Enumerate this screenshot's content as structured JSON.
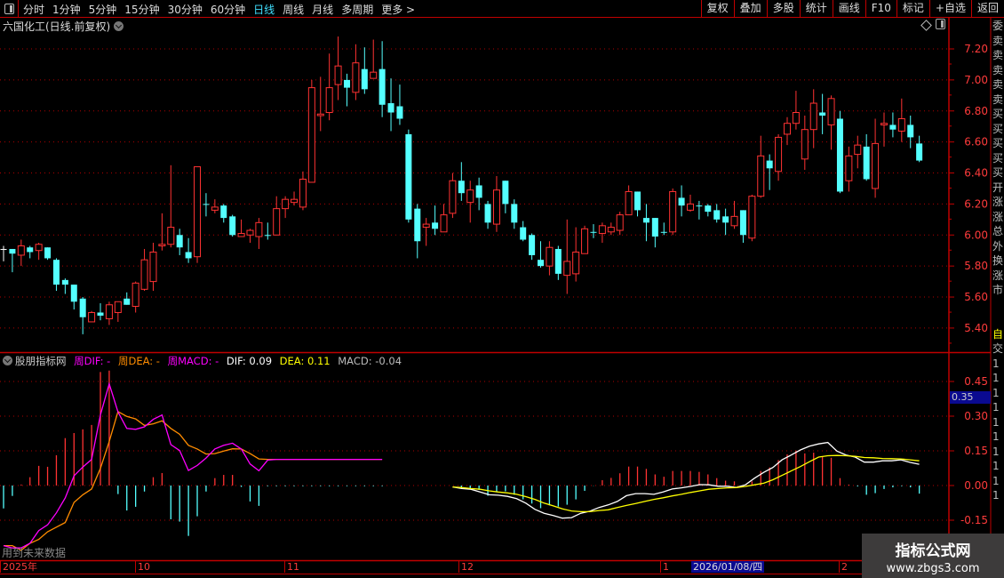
{
  "toolbar": {
    "periods": [
      "分时",
      "1分钟",
      "5分钟",
      "15分钟",
      "30分钟",
      "60分钟",
      "日线",
      "周线",
      "月线",
      "多周期",
      "更多 >"
    ],
    "active_period": "日线",
    "buttons": [
      "复权",
      "叠加",
      "多股",
      "统计",
      "画线",
      "F10",
      "标记",
      "+自选",
      "返回"
    ]
  },
  "title": "六国化工(日线.前复权)",
  "colors": {
    "up": "#ff3232",
    "down": "#54ffff",
    "flat": "#ffffff",
    "grid": "#b00000",
    "axis": "#ff3b3b",
    "wdif": "#ff00ff",
    "wdea": "#ff8c00",
    "dif": "#ffffff",
    "dea": "#ffff00"
  },
  "legend": {
    "name": "股朋指标网",
    "wdif": "周DIF: -",
    "wdea": "周DEA: -",
    "wmacd": "周MACD: -",
    "dif": "DIF: 0.09",
    "dea": "DEA: 0.11",
    "macd": "MACD: -0.04"
  },
  "warning": "用到未来数据",
  "highlight_value": "0.35",
  "time_axis": {
    "labels": [
      "2025年",
      "10",
      "11",
      "12",
      "1",
      "2"
    ],
    "cursor_date": "2026/01/08/四"
  },
  "side_panel": [
    "委",
    "卖",
    "卖",
    "卖",
    "卖",
    "卖",
    "买",
    "买",
    "买",
    "买",
    "买",
    "开",
    "涨",
    "涨",
    "总",
    "外",
    "换",
    "涨",
    "市",
    "",
    "",
    "自",
    "交",
    "1",
    "1",
    "1",
    "1",
    "1",
    "1",
    "1",
    "1",
    "1",
    "1"
  ],
  "watermark": {
    "name": "指标公式网",
    "url": "www.zbgs3.com"
  },
  "chart_data": [
    {
      "type": "candlestick",
      "ylim": [
        5.3,
        7.3
      ],
      "y_ticks": [
        "7.20",
        "7.00",
        "6.80",
        "6.60",
        "6.40",
        "6.20",
        "6.00",
        "5.80",
        "5.60",
        "5.40"
      ],
      "grid": true,
      "ohlc": [
        [
          5.91,
          5.93,
          5.83,
          5.91
        ],
        [
          5.91,
          5.91,
          5.76,
          5.88
        ],
        [
          5.87,
          5.97,
          5.8,
          5.93
        ],
        [
          5.92,
          5.93,
          5.85,
          5.89
        ],
        [
          5.9,
          5.95,
          5.84,
          5.94
        ],
        [
          5.92,
          5.92,
          5.84,
          5.85
        ],
        [
          5.84,
          5.85,
          5.64,
          5.68
        ],
        [
          5.71,
          5.72,
          5.62,
          5.68
        ],
        [
          5.68,
          5.68,
          5.52,
          5.57
        ],
        [
          5.59,
          5.6,
          5.36,
          5.47
        ],
        [
          5.44,
          5.51,
          5.44,
          5.5
        ],
        [
          5.5,
          5.56,
          5.45,
          5.48
        ],
        [
          5.46,
          5.57,
          5.42,
          5.55
        ],
        [
          5.5,
          5.57,
          5.44,
          5.57
        ],
        [
          5.59,
          5.63,
          5.55,
          5.55
        ],
        [
          5.54,
          5.7,
          5.5,
          5.69
        ],
        [
          5.65,
          5.91,
          5.64,
          5.84
        ],
        [
          5.7,
          5.95,
          5.64,
          5.89
        ],
        [
          5.93,
          6.14,
          5.9,
          5.94
        ],
        [
          5.94,
          6.45,
          5.92,
          6.05
        ],
        [
          6.0,
          6.04,
          5.87,
          5.92
        ],
        [
          5.89,
          5.98,
          5.82,
          5.85
        ],
        [
          5.86,
          6.44,
          5.82,
          6.44
        ],
        [
          6.2,
          6.27,
          6.12,
          6.2
        ],
        [
          6.16,
          6.23,
          6.14,
          6.18
        ],
        [
          6.19,
          6.2,
          6.08,
          6.11
        ],
        [
          6.12,
          6.13,
          5.99,
          6.0
        ],
        [
          5.99,
          6.1,
          5.99,
          6.01
        ],
        [
          6.0,
          6.04,
          5.95,
          6.03
        ],
        [
          5.99,
          6.11,
          5.91,
          6.08
        ],
        [
          6.0,
          6.08,
          5.97,
          6.0
        ],
        [
          6.0,
          6.25,
          6.0,
          6.17
        ],
        [
          6.17,
          6.25,
          6.11,
          6.23
        ],
        [
          6.21,
          6.28,
          6.19,
          6.23
        ],
        [
          6.18,
          6.41,
          6.16,
          6.36
        ],
        [
          6.34,
          7.0,
          6.34,
          6.95
        ],
        [
          6.77,
          7.02,
          6.67,
          6.78
        ],
        [
          6.79,
          7.17,
          6.74,
          6.95
        ],
        [
          6.97,
          7.28,
          6.87,
          7.09
        ],
        [
          7.0,
          7.04,
          6.83,
          6.95
        ],
        [
          6.92,
          7.23,
          6.87,
          7.11
        ],
        [
          7.07,
          7.21,
          6.91,
          6.94
        ],
        [
          7.01,
          7.26,
          7.01,
          7.05
        ],
        [
          7.07,
          7.25,
          6.76,
          6.84
        ],
        [
          6.85,
          7.01,
          6.67,
          6.79
        ],
        [
          6.83,
          6.97,
          6.71,
          6.75
        ],
        [
          6.65,
          6.68,
          6.08,
          6.1
        ],
        [
          6.17,
          6.2,
          5.85,
          5.96
        ],
        [
          6.05,
          6.11,
          5.93,
          6.07
        ],
        [
          6.08,
          6.19,
          6.0,
          6.04
        ],
        [
          6.02,
          6.2,
          6.02,
          6.13
        ],
        [
          6.14,
          6.4,
          6.11,
          6.35
        ],
        [
          6.35,
          6.47,
          6.22,
          6.27
        ],
        [
          6.21,
          6.35,
          6.08,
          6.29
        ],
        [
          6.32,
          6.37,
          6.16,
          6.24
        ],
        [
          6.2,
          6.22,
          6.04,
          6.08
        ],
        [
          6.07,
          6.38,
          6.02,
          6.29
        ],
        [
          6.35,
          6.35,
          6.14,
          6.2
        ],
        [
          6.2,
          6.23,
          6.04,
          6.08
        ],
        [
          6.05,
          6.09,
          5.96,
          5.97
        ],
        [
          6.0,
          6.01,
          5.84,
          5.87
        ],
        [
          5.84,
          5.96,
          5.79,
          5.8
        ],
        [
          5.8,
          5.96,
          5.74,
          5.92
        ],
        [
          5.91,
          5.93,
          5.71,
          5.75
        ],
        [
          5.74,
          6.1,
          5.62,
          5.83
        ],
        [
          5.75,
          6.05,
          5.7,
          5.89
        ],
        [
          5.88,
          6.06,
          5.88,
          6.04
        ],
        [
          6.02,
          6.07,
          5.98,
          6.02
        ],
        [
          6.01,
          6.08,
          5.95,
          6.06
        ],
        [
          6.02,
          6.08,
          6.0,
          6.05
        ],
        [
          6.03,
          6.15,
          6.0,
          6.13
        ],
        [
          6.13,
          6.32,
          6.13,
          6.28
        ],
        [
          6.28,
          6.28,
          6.12,
          6.16
        ],
        [
          6.11,
          6.2,
          5.96,
          6.08
        ],
        [
          6.11,
          6.11,
          5.92,
          5.99
        ],
        [
          6.02,
          6.08,
          6.0,
          6.02
        ],
        [
          6.02,
          6.3,
          6.0,
          6.28
        ],
        [
          6.24,
          6.32,
          6.12,
          6.19
        ],
        [
          6.16,
          6.26,
          6.15,
          6.2
        ],
        [
          6.19,
          6.22,
          6.1,
          6.19
        ],
        [
          6.19,
          6.2,
          6.12,
          6.15
        ],
        [
          6.16,
          6.2,
          6.08,
          6.1
        ],
        [
          6.12,
          6.17,
          6.0,
          6.08
        ],
        [
          6.06,
          6.22,
          6.04,
          6.12
        ],
        [
          6.16,
          6.16,
          5.95,
          6.0
        ],
        [
          5.98,
          6.26,
          5.96,
          6.25
        ],
        [
          6.25,
          6.64,
          6.24,
          6.51
        ],
        [
          6.48,
          6.52,
          6.29,
          6.43
        ],
        [
          6.41,
          6.65,
          6.35,
          6.63
        ],
        [
          6.65,
          6.76,
          6.58,
          6.72
        ],
        [
          6.72,
          6.93,
          6.68,
          6.79
        ],
        [
          6.49,
          6.77,
          6.42,
          6.68
        ],
        [
          6.68,
          6.94,
          6.56,
          6.85
        ],
        [
          6.79,
          6.91,
          6.65,
          6.77
        ],
        [
          6.71,
          6.9,
          6.55,
          6.88
        ],
        [
          6.75,
          6.8,
          6.27,
          6.28
        ],
        [
          6.35,
          6.57,
          6.28,
          6.51
        ],
        [
          6.52,
          6.64,
          6.43,
          6.58
        ],
        [
          6.57,
          6.65,
          6.35,
          6.36
        ],
        [
          6.3,
          6.75,
          6.24,
          6.59
        ],
        [
          6.71,
          6.79,
          6.57,
          6.72
        ],
        [
          6.71,
          6.79,
          6.63,
          6.68
        ],
        [
          6.67,
          6.88,
          6.6,
          6.75
        ],
        [
          6.71,
          6.77,
          6.56,
          6.63
        ],
        [
          6.59,
          6.64,
          6.47,
          6.48
        ]
      ]
    },
    {
      "type": "macd",
      "ylim": [
        -0.3,
        0.5
      ],
      "y_ticks": [
        "0.45",
        "0.30",
        "0.15",
        "0.00",
        "-0.15"
      ],
      "grid": true,
      "weekly": {
        "dif": [
          -0.26,
          -0.27,
          -0.27,
          -0.25,
          -0.195,
          -0.17,
          -0.118,
          -0.054,
          0.042,
          0.08,
          0.113,
          0.305,
          0.44,
          0.318,
          0.247,
          0.243,
          0.254,
          0.286,
          0.305,
          0.177,
          0.151,
          0.065,
          0.087,
          0.119,
          0.158,
          0.174,
          0.183,
          0.158,
          0.093,
          0.064,
          0.11,
          0.113,
          0.113,
          0.113,
          0.113,
          0.113,
          0.113,
          0.113,
          0.113,
          0.113,
          0.113,
          0.113,
          0.113,
          0.113
        ],
        "dea": [
          -0.26,
          -0.26,
          -0.28,
          -0.25,
          -0.233,
          -0.2,
          -0.18,
          -0.16,
          -0.073,
          -0.04,
          -0.015,
          0.074,
          0.19,
          0.32,
          0.299,
          0.288,
          0.26,
          0.267,
          0.28,
          0.247,
          0.222,
          0.174,
          0.158,
          0.136,
          0.138,
          0.149,
          0.159,
          0.158,
          0.138,
          0.115,
          0.113,
          0.113,
          0.113,
          0.113,
          0.113,
          0.113,
          0.113,
          0.113,
          0.113,
          0.113,
          0.113,
          0.113,
          0.113,
          0.113
        ],
        "macd": [
          -0.099,
          -0.045,
          0.004,
          0.036,
          0.085,
          0.081,
          0.131,
          0.205,
          0.227,
          0.243,
          0.262,
          0.491,
          0.497,
          -0.037,
          -0.108,
          -0.092,
          -0.026,
          0.036,
          0.054,
          -0.146,
          -0.156,
          -0.218,
          -0.133,
          -0.026,
          0.032,
          0.046,
          0.046,
          -0.006,
          -0.069,
          -0.088,
          -0.003,
          -0.003,
          -0.003,
          -0.003,
          -0.003,
          -0.003,
          -0.003,
          -0.003,
          -0.003,
          -0.003,
          -0.003,
          -0.003,
          -0.003,
          -0.003
        ]
      },
      "daily": {
        "dif": [
          -0.006,
          -0.013,
          -0.016,
          -0.028,
          -0.04,
          -0.042,
          -0.047,
          -0.057,
          -0.076,
          -0.103,
          -0.12,
          -0.13,
          -0.141,
          -0.139,
          -0.12,
          -0.111,
          -0.095,
          -0.084,
          -0.069,
          -0.044,
          -0.035,
          -0.035,
          -0.038,
          -0.028,
          -0.015,
          -0.01,
          -0.004,
          0.004,
          0.003,
          -0.003,
          -0.003,
          -0.008,
          0.003,
          0.032,
          0.057,
          0.078,
          0.111,
          0.132,
          0.154,
          0.17,
          0.18,
          0.186,
          0.149,
          0.132,
          0.123,
          0.101,
          0.101,
          0.107,
          0.107,
          0.111,
          0.1,
          0.092
        ],
        "dea": [
          -0.006,
          -0.009,
          -0.013,
          -0.016,
          -0.023,
          -0.028,
          -0.032,
          -0.038,
          -0.048,
          -0.06,
          -0.076,
          -0.088,
          -0.101,
          -0.11,
          -0.113,
          -0.113,
          -0.108,
          -0.105,
          -0.095,
          -0.086,
          -0.078,
          -0.069,
          -0.06,
          -0.053,
          -0.045,
          -0.038,
          -0.03,
          -0.023,
          -0.016,
          -0.013,
          -0.01,
          -0.009,
          -0.004,
          0.003,
          0.01,
          0.025,
          0.044,
          0.063,
          0.082,
          0.103,
          0.123,
          0.129,
          0.13,
          0.129,
          0.126,
          0.121,
          0.12,
          0.117,
          0.116,
          0.115,
          0.111,
          0.107
        ],
        "macd": [
          -0.013,
          -0.013,
          -0.019,
          -0.044,
          -0.028,
          -0.025,
          -0.04,
          -0.06,
          -0.078,
          -0.098,
          -0.086,
          -0.091,
          -0.083,
          -0.06,
          -0.023,
          -0.001,
          0.023,
          0.033,
          0.053,
          0.082,
          0.082,
          0.072,
          0.048,
          0.038,
          0.063,
          0.063,
          0.063,
          0.059,
          0.048,
          0.032,
          0.021,
          0.018,
          0.001,
          0.018,
          0.063,
          0.078,
          0.11,
          0.135,
          0.151,
          0.139,
          0.142,
          0.127,
          0.12,
          0.032,
          0.004,
          -0.004,
          -0.04,
          -0.033,
          -0.015,
          -0.008,
          -0.003,
          -0.008,
          -0.035
        ]
      }
    }
  ]
}
